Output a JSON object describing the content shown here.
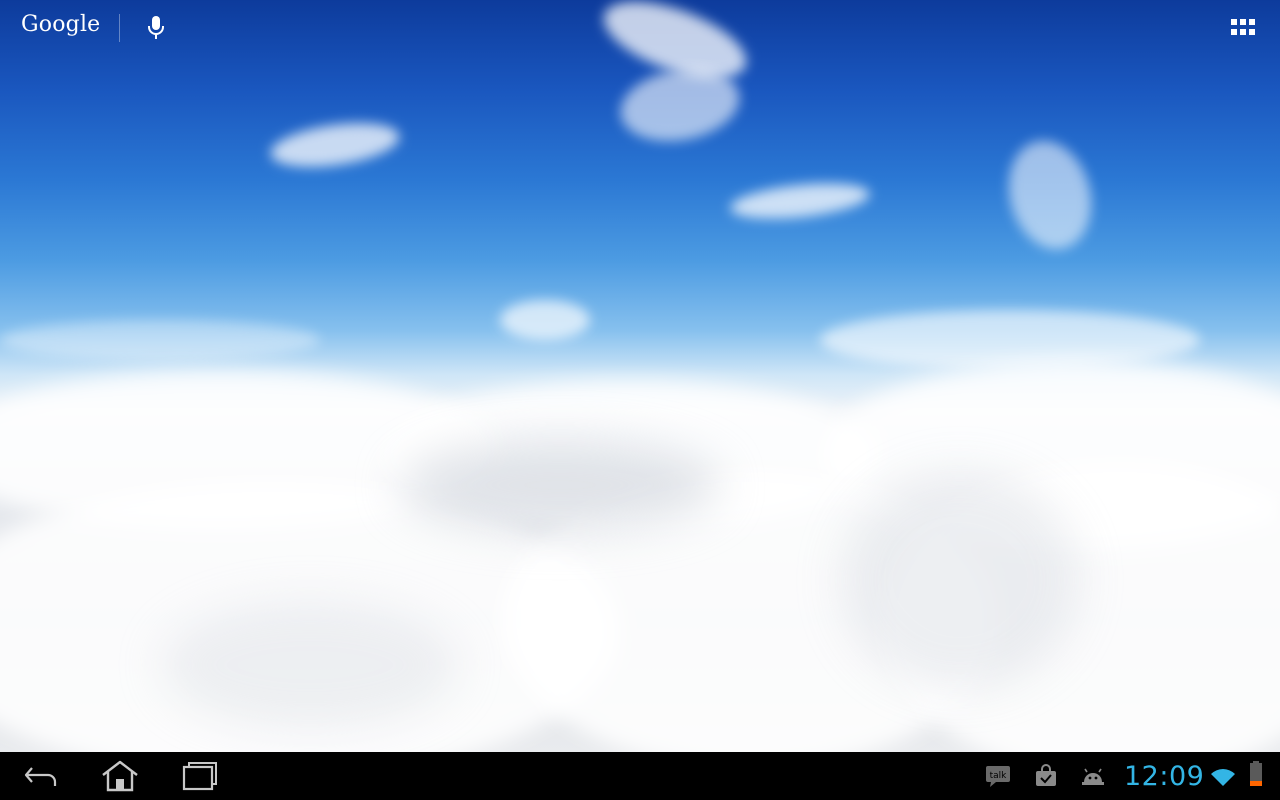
{
  "top_bar": {
    "search_logo": "Google",
    "voice_icon": "microphone-icon",
    "apps_icon": "all-apps-grid-icon"
  },
  "navigation_bar": {
    "back_icon": "back-arrow-icon",
    "home_icon": "home-icon",
    "recents_icon": "recent-apps-icon"
  },
  "status_bar": {
    "notifications": [
      {
        "icon": "talk-icon",
        "text": "talk"
      },
      {
        "icon": "market-bag-icon"
      },
      {
        "icon": "android-debug-icon"
      }
    ],
    "clock": "12:09",
    "wifi_icon": "wifi-icon",
    "battery_icon": "battery-icon",
    "battery_level": 0.2,
    "accent_color": "#33b5e5",
    "battery_low_color": "#ff6600"
  }
}
